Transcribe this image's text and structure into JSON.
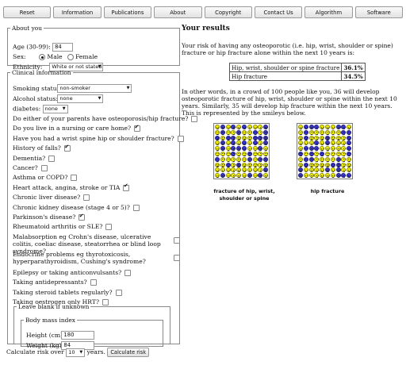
{
  "nav": [
    "Reset",
    "Information",
    "Publications",
    "About",
    "Copyright",
    "Contact Us",
    "Algorithm",
    "Software"
  ],
  "about": {
    "legend": "About you",
    "age_label": "Age (30-99):",
    "age_value": "84",
    "sex_label": "Sex:",
    "male": "Male",
    "female": "Female",
    "ethnicity_label": "Ethnicity:",
    "ethnicity_value": "White or not stated"
  },
  "clinical": {
    "legend": "Clinical information",
    "smoking_label": "Smoking status:",
    "smoking_value": "non-smoker",
    "alcohol_label": "Alcohol status:",
    "alcohol_value": "none",
    "diabetes_label": "diabetes:",
    "diabetes_value": "none",
    "questions": [
      {
        "text": "Do either of your parents have osteoporosis/hip fracture?",
        "checked": false
      },
      {
        "text": "Do you live in a nursing or care home?",
        "checked": true
      },
      {
        "text": "Have you had a wrist spine hip or shoulder fracture?",
        "checked": false
      },
      {
        "text": "History of falls?",
        "checked": true
      },
      {
        "text": "Dementia?",
        "checked": false
      },
      {
        "text": "Cancer?",
        "checked": false
      },
      {
        "text": "Asthma or COPD?",
        "checked": false
      },
      {
        "text": "Heart attack, angina, stroke or TIA",
        "checked": true
      },
      {
        "text": "Chronic liver disease?",
        "checked": false
      },
      {
        "text": "Chronic kidney disease (stage 4 or 5)?",
        "checked": false
      },
      {
        "text": "Parkinson's disease?",
        "checked": true
      },
      {
        "text": "Rheumatoid arthritis or SLE?",
        "checked": false
      },
      {
        "text": "Malabsorption eg Crohn's disease, ulcerative colitis, coeliac disease, steatorrhea or blind loop syndrome?",
        "checked": false
      },
      {
        "text": "Endocrine problems eg thyrotoxicosis, hyperparathyroidism, Cushing's syndrome?",
        "checked": false
      },
      {
        "text": "Epilepsy or taking anticonvulsants?",
        "checked": false
      },
      {
        "text": "Taking antidepressants?",
        "checked": false
      },
      {
        "text": "Taking steroid tablets regularly?",
        "checked": false
      },
      {
        "text": "Taking oestrogen only HRT?",
        "checked": false
      }
    ]
  },
  "bmi": {
    "outer_legend": "Leave blank if unknown",
    "inner_legend": "Body mass index",
    "height_label": "Height (cm):",
    "height_value": "180",
    "weight_label": "Weight (kg):",
    "weight_value": "84"
  },
  "footer": {
    "calc_label": "Calculate risk over",
    "years_value": "10",
    "years_label": "years.",
    "button": "Calculate risk"
  },
  "results": {
    "title": "Your results",
    "intro": "Your risk of having any osteoporotic (i.e. hip, wrist, shoulder or spine) fracture or hip fracture alone within the next 10 years is:",
    "table": [
      {
        "label": "Hip, wrist, shoulder or spine fracture",
        "value": "36.1%"
      },
      {
        "label": "Hip fracture",
        "value": "34.5%"
      }
    ],
    "explain": "In other words, in a crowd of 100 people like you, 36 will develop osteoporotic fracture of hip, wrist, shoulder or spine within the next 10 years. Similarly, 35 will develop hip fracture within the next 10 years. This is represented by the smileys below.",
    "grid1_caption": "fracture of hip, wrist, shoulder or spine",
    "grid2_caption": "hip fracture",
    "grid1_affected": 36,
    "grid2_affected": 35,
    "face_colors": {
      "affected": "#3a37c9",
      "unaffected": "#f4f200"
    }
  }
}
